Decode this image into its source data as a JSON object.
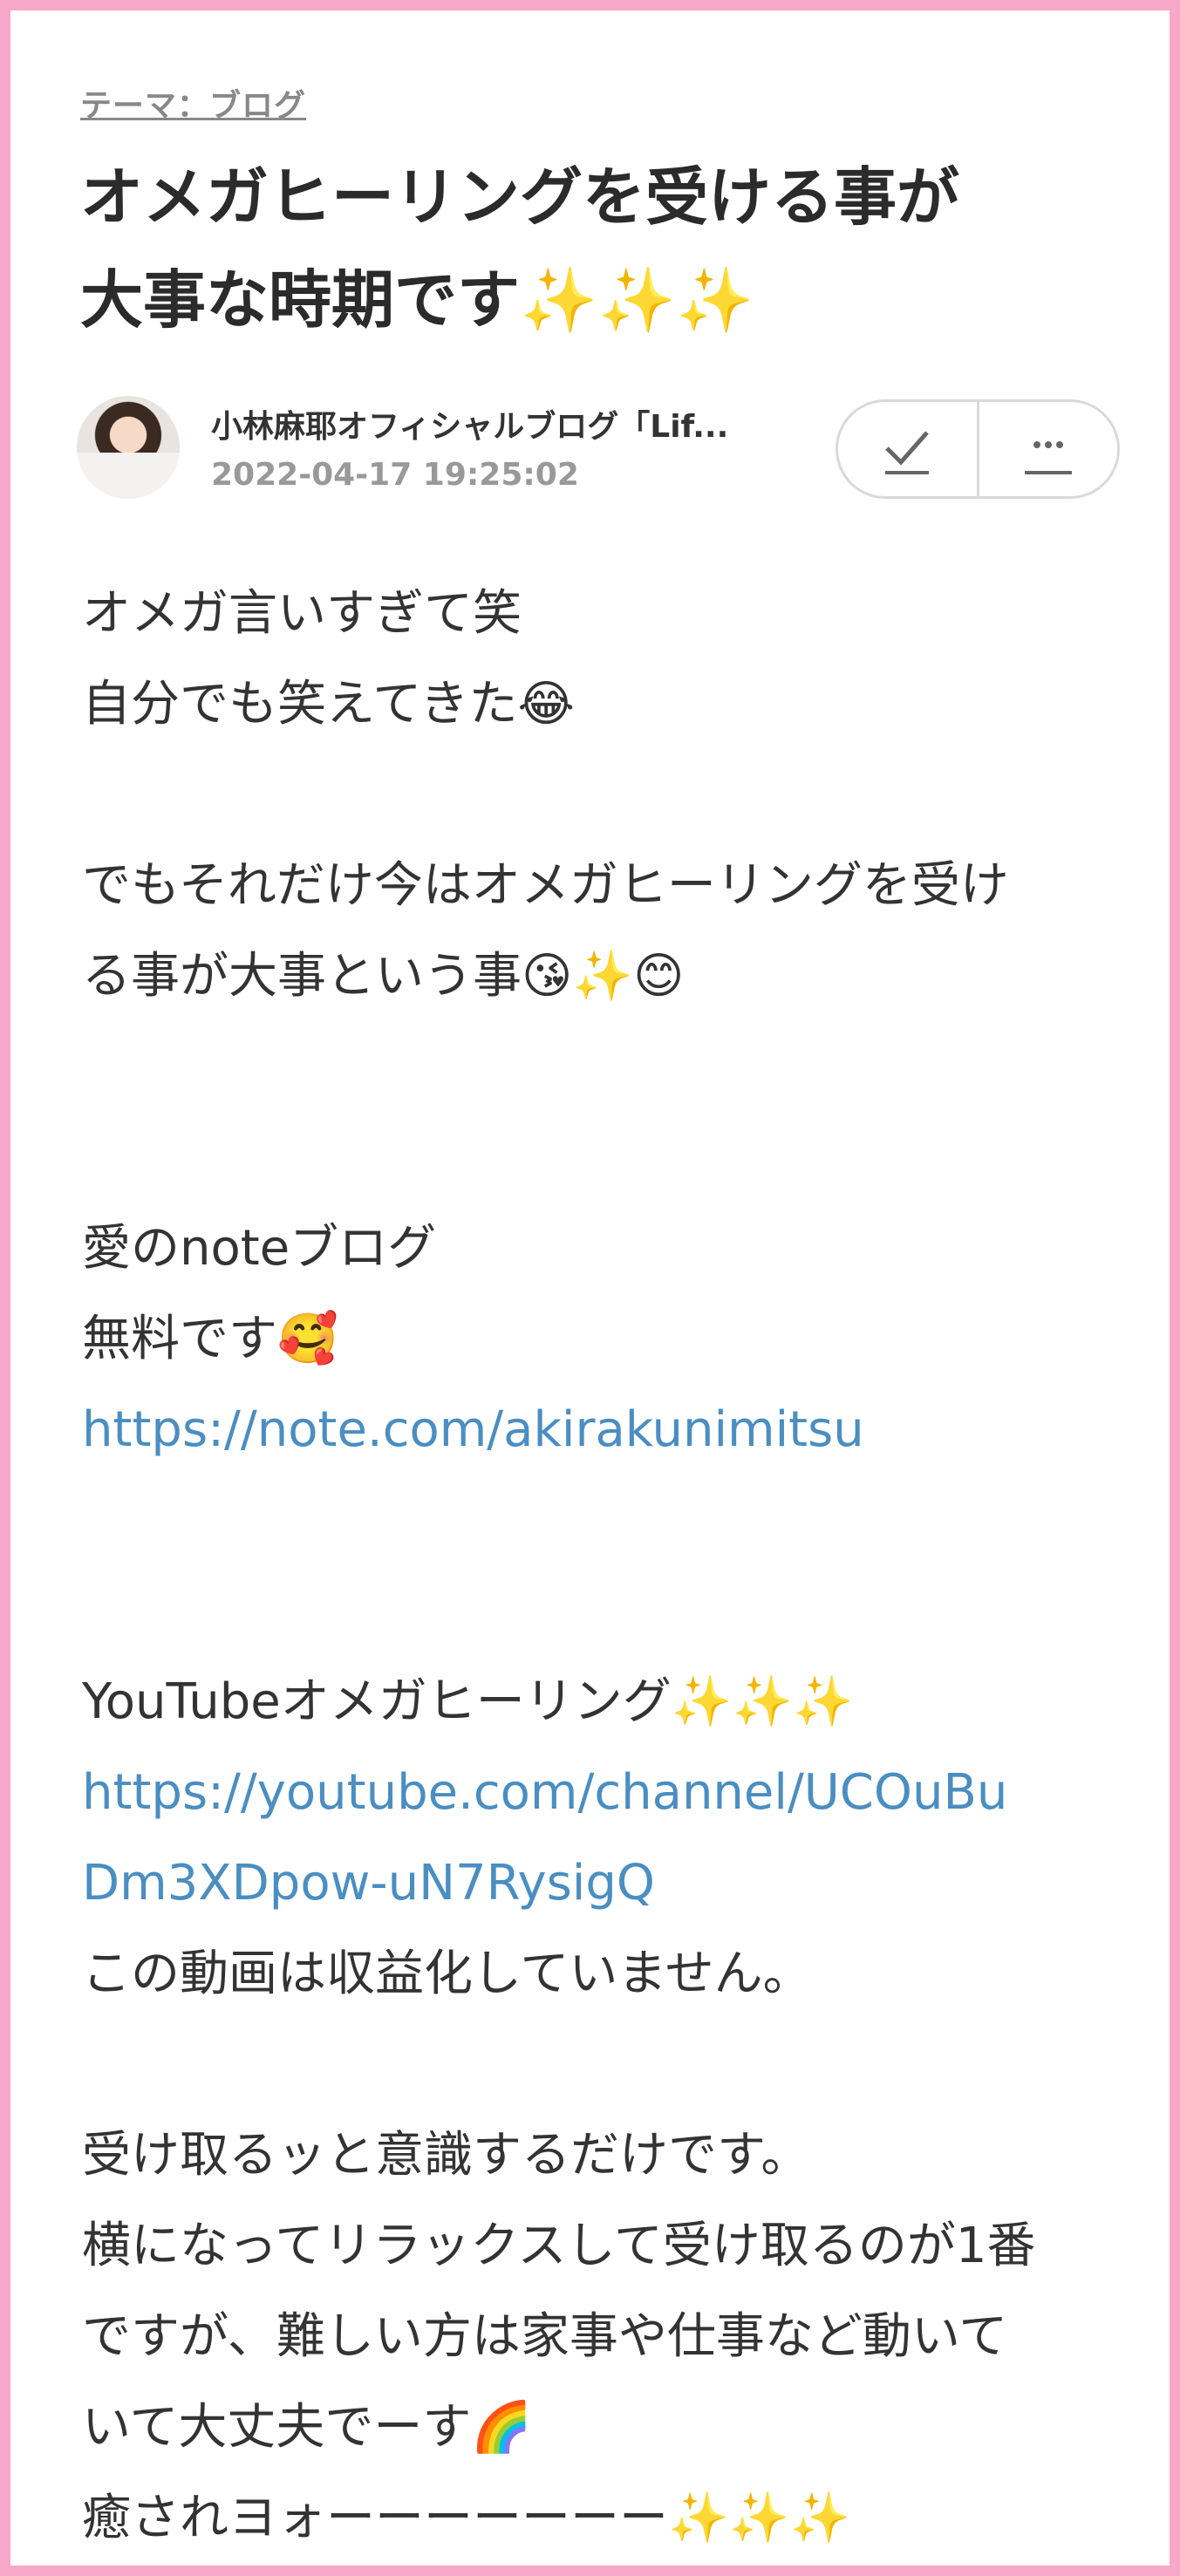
{
  "theme_label": "テーマ：ブログ",
  "title_line1": "オメガヒーリングを受ける事が",
  "title_line2": "大事な時期です✨✨✨",
  "author": {
    "blog_name": "小林麻耶オフィシャルブログ「Lif...",
    "datetime": "2022-04-17 19:25:02"
  },
  "actions": {
    "check_icon": "check-icon",
    "more_icon": "more-icon"
  },
  "body": {
    "l1": "オメガ言いすぎて笑",
    "l2": "自分でも笑えてきた😂",
    "l3": "でもそれだけ今はオメガヒーリングを受け",
    "l4": "る事が大事という事😘✨😊",
    "l5": "愛のnoteブログ",
    "l6": "無料です🥰",
    "l7": "https://note.com/akirakunimitsu",
    "l8": "YouTubeオメガヒーリング✨✨✨",
    "l9": "https://youtube.com/channel/UCOuBu",
    "l10": "Dm3XDpow-uN7RysigQ",
    "l11": "この動画は収益化していません。",
    "l12": "受け取るッと意識するだけです。",
    "l13": "横になってリラックスして受け取るのが1番",
    "l14": "ですが、難しい方は家事や仕事など動いて",
    "l15": "いて大丈夫でーす🌈",
    "l16": "癒されヨォーーーーーーー✨✨✨"
  },
  "colors": {
    "frame": "#f7a8c8",
    "link": "#4a8ec2",
    "text": "#333333"
  }
}
